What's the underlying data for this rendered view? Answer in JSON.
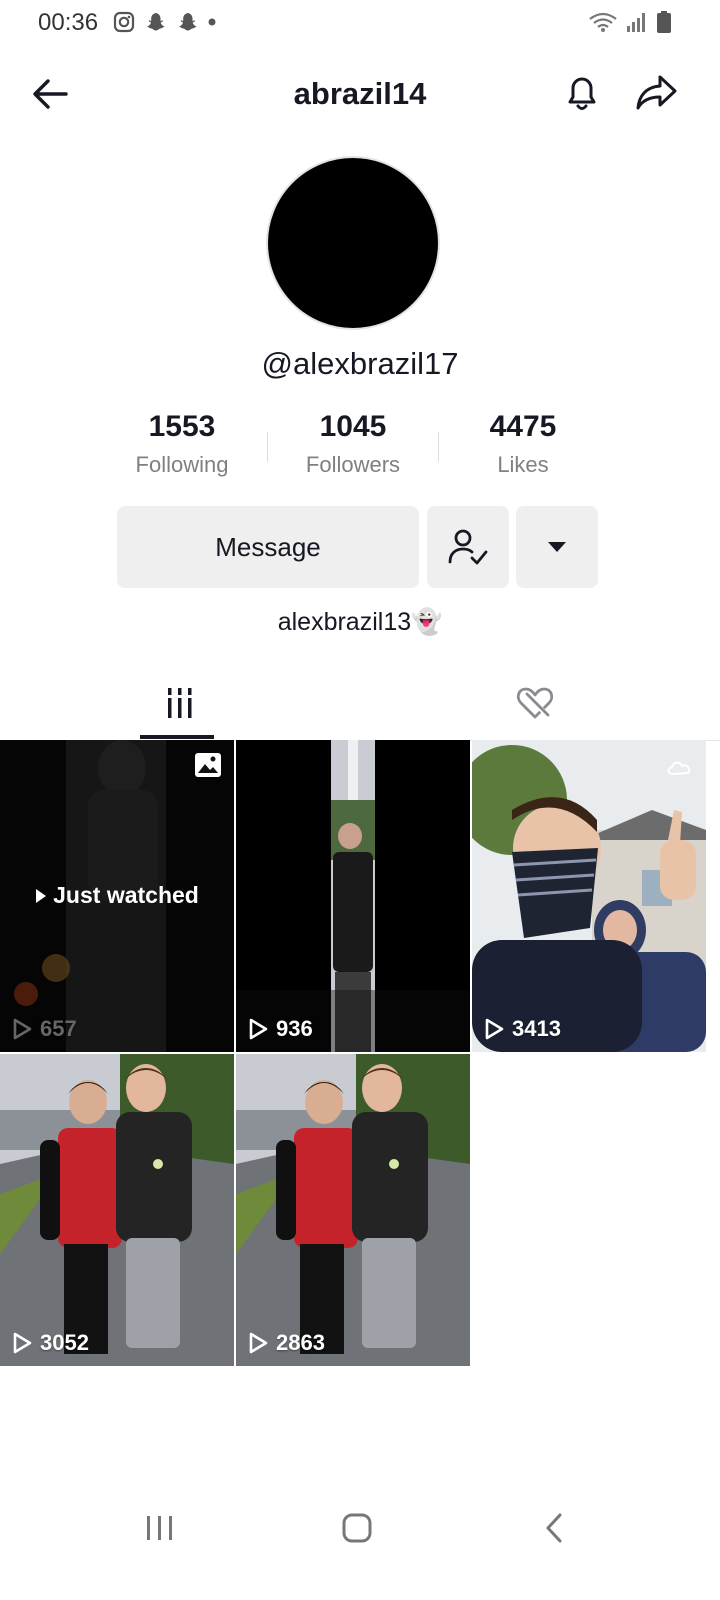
{
  "status": {
    "time": "00:36",
    "left_icons": [
      "instagram-icon",
      "snapchat-icon",
      "snapchat-icon",
      "dot-icon"
    ],
    "right_icons": [
      "wifi-icon",
      "signal-icon",
      "battery-icon"
    ]
  },
  "header": {
    "title": "abrazil14"
  },
  "profile": {
    "handle": "@alexbrazil17",
    "bio": "alexbrazil13👻",
    "stats": [
      {
        "value": "1553",
        "label": "Following"
      },
      {
        "value": "1045",
        "label": "Followers"
      },
      {
        "value": "4475",
        "label": "Likes"
      }
    ],
    "message_label": "Message"
  },
  "tabs": [
    {
      "name": "videos",
      "icon": "grid-icon",
      "active": true
    },
    {
      "name": "liked",
      "icon": "hidden-heart-icon",
      "active": false
    }
  ],
  "videos": [
    {
      "views": "657",
      "overlay": "Just watched",
      "dim": true,
      "badge": "image-icon"
    },
    {
      "views": "936",
      "overlay": "",
      "dim": false
    },
    {
      "views": "3413",
      "overlay": "",
      "dim": false
    },
    {
      "views": "3052",
      "overlay": "",
      "dim": false
    },
    {
      "views": "2863",
      "overlay": "",
      "dim": false
    }
  ],
  "colors": {
    "text": "#161823",
    "button_bg": "#efefef",
    "secondary_text": "#808080"
  }
}
